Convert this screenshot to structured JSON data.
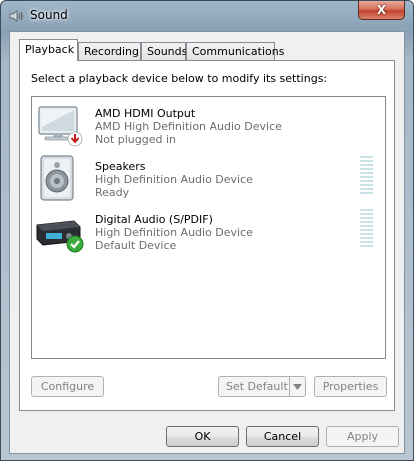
{
  "window": {
    "title": "Sound",
    "close_label": "X"
  },
  "tabs": [
    {
      "label": "Playback"
    },
    {
      "label": "Recording"
    },
    {
      "label": "Sounds"
    },
    {
      "label": "Communications"
    }
  ],
  "instruction": "Select a playback device below to modify its settings:",
  "devices": [
    {
      "name": "AMD HDMI Output",
      "driver": "AMD High Definition Audio Device",
      "status": "Not plugged in",
      "icon": "monitor-icon",
      "badge": "red-down-arrow"
    },
    {
      "name": "Speakers",
      "driver": "High Definition Audio Device",
      "status": "Ready",
      "icon": "speaker-icon"
    },
    {
      "name": "Digital Audio (S/PDIF)",
      "driver": "High Definition Audio Device",
      "status": "Default Device",
      "icon": "digital-audio-receiver-icon",
      "badge": "green-check"
    }
  ],
  "buttons": {
    "configure": "Configure",
    "set_default": "Set Default",
    "properties": "Properties",
    "ok": "OK",
    "cancel": "Cancel",
    "apply": "Apply"
  }
}
